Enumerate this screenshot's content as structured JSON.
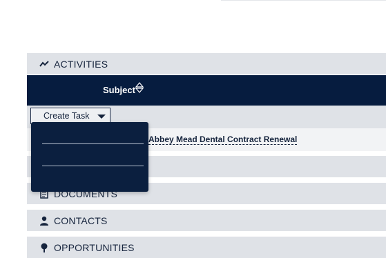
{
  "panels": {
    "activities": {
      "label": "ACTIVITIES",
      "icon": "activity-icon"
    },
    "documents": {
      "label": "DOCUMENTS",
      "icon": "document-icon"
    },
    "contacts": {
      "label": "CONTACTS",
      "icon": "person-icon"
    },
    "opportunities": {
      "label": "OPPORTUNITIES",
      "icon": "pin-icon"
    }
  },
  "table": {
    "header_subject": "Subject",
    "sort_icon": "sort-icon"
  },
  "toolbar": {
    "create_task_label": "Create Task"
  },
  "rows": [
    {
      "subject": "Abbey Mead Dental Contract Renewal"
    }
  ],
  "dropdown": {
    "items": [
      "",
      ""
    ]
  },
  "colors": {
    "header_bg": "#061c3f",
    "panel_bg": "#dfe2e7",
    "dropdown_bg": "#0b1f3f"
  }
}
